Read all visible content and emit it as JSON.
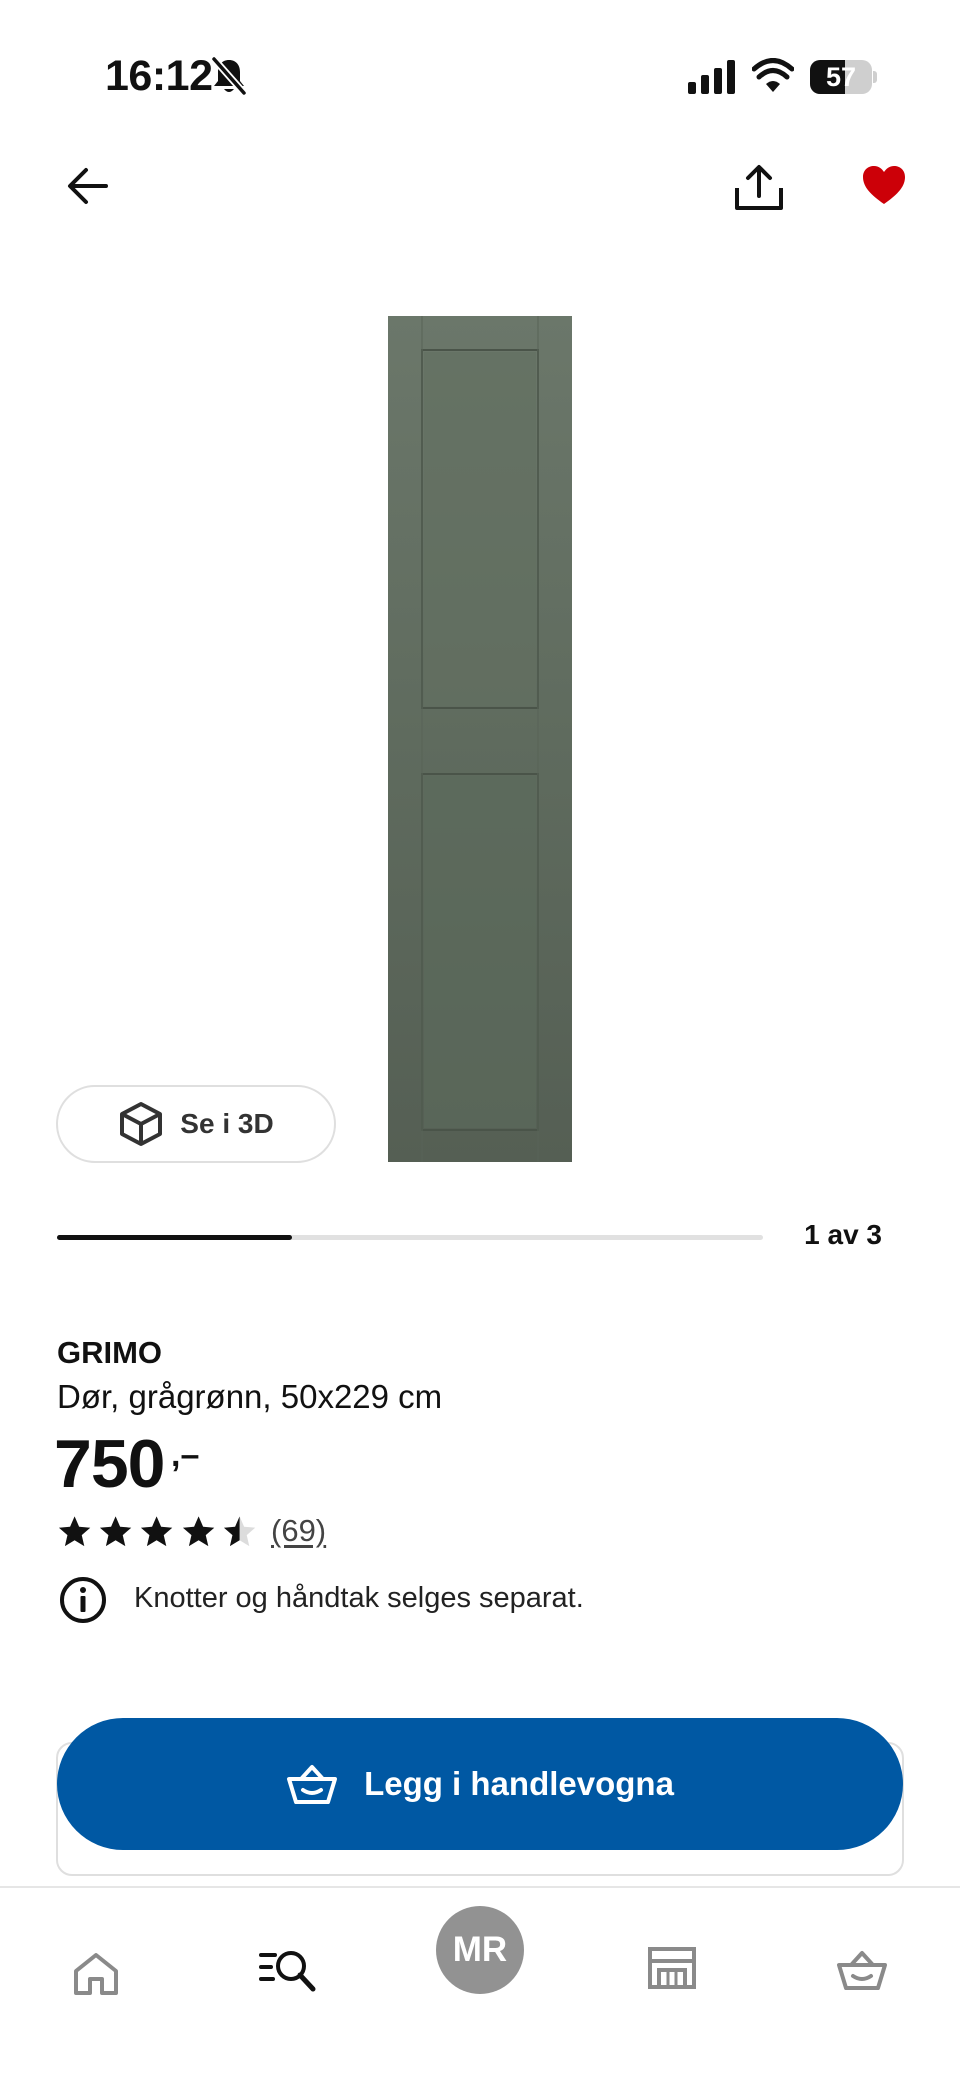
{
  "status_bar": {
    "time": "16:12",
    "battery_percent": "57",
    "battery_level": 0.57,
    "icons": [
      "bell-slash-icon",
      "cellular-signal-icon",
      "wifi-icon",
      "battery-icon"
    ]
  },
  "header": {
    "icons": [
      "arrow-left-icon",
      "share-icon",
      "heart-icon"
    ],
    "favorite_color": "#cc0008"
  },
  "gallery": {
    "view_3d_label": "Se i 3D",
    "counter": "1 av 3",
    "progress": 0.333,
    "product_color": "#5f6a5e"
  },
  "product": {
    "name": "GRIMO",
    "description": "Dør, grågrønn, 50x229 cm",
    "price": "750",
    "price_suffix": ",–",
    "rating": 4.5,
    "rating_max": 5,
    "review_count": "(69)",
    "info_text": "Knotter og håndtak selges separat."
  },
  "actions": {
    "add_to_cart_label": "Legg i handlevogna",
    "accent_color": "#0058a3"
  },
  "tab_bar": {
    "profile_initials": "MR",
    "tabs": [
      "home-icon",
      "search-icon",
      "profile-avatar",
      "store-icon",
      "shopping-basket-icon"
    ]
  }
}
